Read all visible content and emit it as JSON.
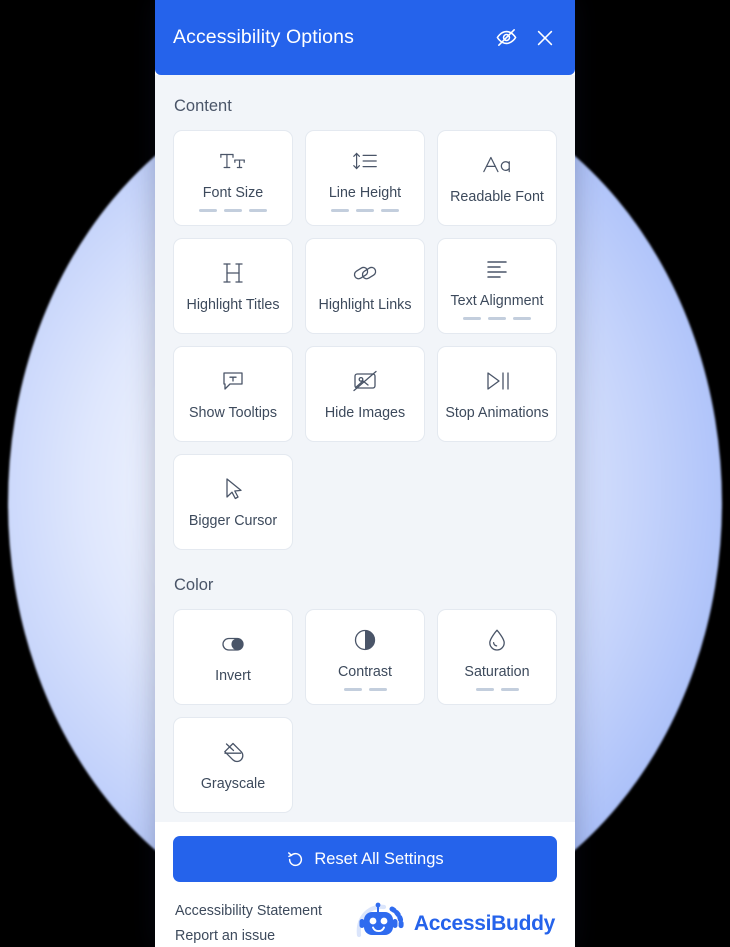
{
  "header": {
    "title": "Accessibility Options",
    "hide_icon": "eye-off-icon",
    "close_icon": "close-icon"
  },
  "sections": [
    {
      "id": "content",
      "title": "Content",
      "tiles": [
        {
          "label": "Font Size",
          "icon": "font-size-icon",
          "steps": 3
        },
        {
          "label": "Line Height",
          "icon": "line-height-icon",
          "steps": 3
        },
        {
          "label": "Readable Font",
          "icon": "readable-font-icon",
          "steps": 0
        },
        {
          "label": "Highlight Titles",
          "icon": "highlight-titles-icon",
          "steps": 0
        },
        {
          "label": "Highlight Links",
          "icon": "highlight-links-icon",
          "steps": 0
        },
        {
          "label": "Text Alignment",
          "icon": "text-alignment-icon",
          "steps": 3
        },
        {
          "label": "Show Tooltips",
          "icon": "tooltip-icon",
          "steps": 0
        },
        {
          "label": "Hide Images",
          "icon": "hide-images-icon",
          "steps": 0
        },
        {
          "label": "Stop Animations",
          "icon": "stop-animations-icon",
          "steps": 0
        },
        {
          "label": "Bigger Cursor",
          "icon": "cursor-icon",
          "steps": 0
        }
      ]
    },
    {
      "id": "color",
      "title": "Color",
      "tiles": [
        {
          "label": "Invert",
          "icon": "invert-toggle-icon",
          "steps": 0
        },
        {
          "label": "Contrast",
          "icon": "contrast-icon",
          "steps": 2
        },
        {
          "label": "Saturation",
          "icon": "saturation-icon",
          "steps": 2
        },
        {
          "label": "Grayscale",
          "icon": "grayscale-icon",
          "steps": 0
        }
      ]
    }
  ],
  "reset": {
    "label": "Reset All Settings",
    "icon": "reset-arrow-icon"
  },
  "footer": {
    "links": [
      {
        "label": "Accessibility Statement"
      },
      {
        "label": "Report an issue"
      }
    ],
    "brand": {
      "name": "AccessiBuddy",
      "logo": "robot-mascot-logo"
    }
  },
  "colors": {
    "accent": "#2563eb",
    "panel_bg": "#f2f5f9",
    "tile_bg": "#ffffff",
    "tile_border": "#e4e9f0",
    "text": "#3d4a5c",
    "step_dash": "#c3cedd",
    "backdrop": "#000000",
    "glow": "#8aa9f6"
  }
}
